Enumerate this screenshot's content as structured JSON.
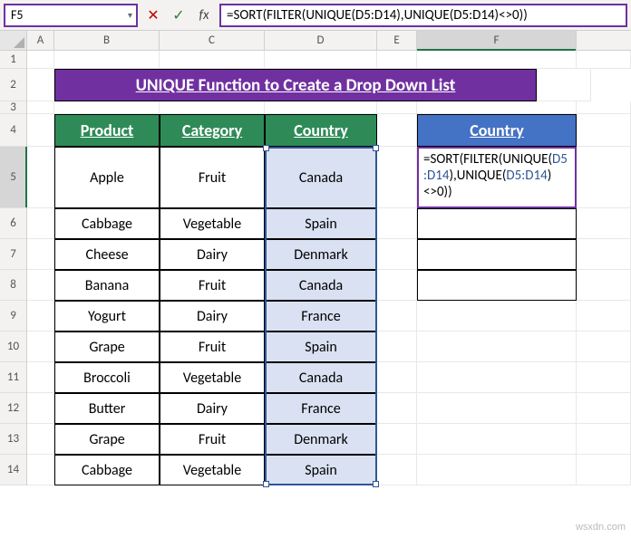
{
  "cellRef": "F5",
  "formulaBar": "=SORT(FILTER(UNIQUE(D5:D14),UNIQUE(D5:D14)<>0))",
  "columns": [
    "A",
    "B",
    "C",
    "D",
    "E",
    "F"
  ],
  "title": "UNIQUE Function to Create a Drop Down List",
  "headers": {
    "product": "Product",
    "category": "Category",
    "country": "Country"
  },
  "countryHeader": "Country",
  "rows": [
    {
      "product": "Apple",
      "category": "Fruit",
      "country": "Canada"
    },
    {
      "product": "Cabbage",
      "category": "Vegetable",
      "country": "Spain"
    },
    {
      "product": "Cheese",
      "category": "Dairy",
      "country": "Denmark"
    },
    {
      "product": "Banana",
      "category": "Fruit",
      "country": "Canada"
    },
    {
      "product": "Yogurt",
      "category": "Dairy",
      "country": "France"
    },
    {
      "product": "Grape",
      "category": "Fruit",
      "country": "Spain"
    },
    {
      "product": "Broccoli",
      "category": "Vegetable",
      "country": "Canada"
    },
    {
      "product": "Butter",
      "category": "Dairy",
      "country": "France"
    },
    {
      "product": "Grape",
      "category": "Fruit",
      "country": "Denmark"
    },
    {
      "product": "Cabbage",
      "category": "Vegetable",
      "country": "Spain"
    }
  ],
  "activeCell": {
    "parts": [
      {
        "t": "=SORT(FILTER(UNIQUE("
      },
      {
        "t": "D5:D14",
        "ref": true
      },
      {
        "t": "),UNIQUE("
      },
      {
        "t": "D5:D14",
        "ref": true
      },
      {
        "t": ")<>0))"
      }
    ]
  },
  "watermark": "wsxdn.com"
}
